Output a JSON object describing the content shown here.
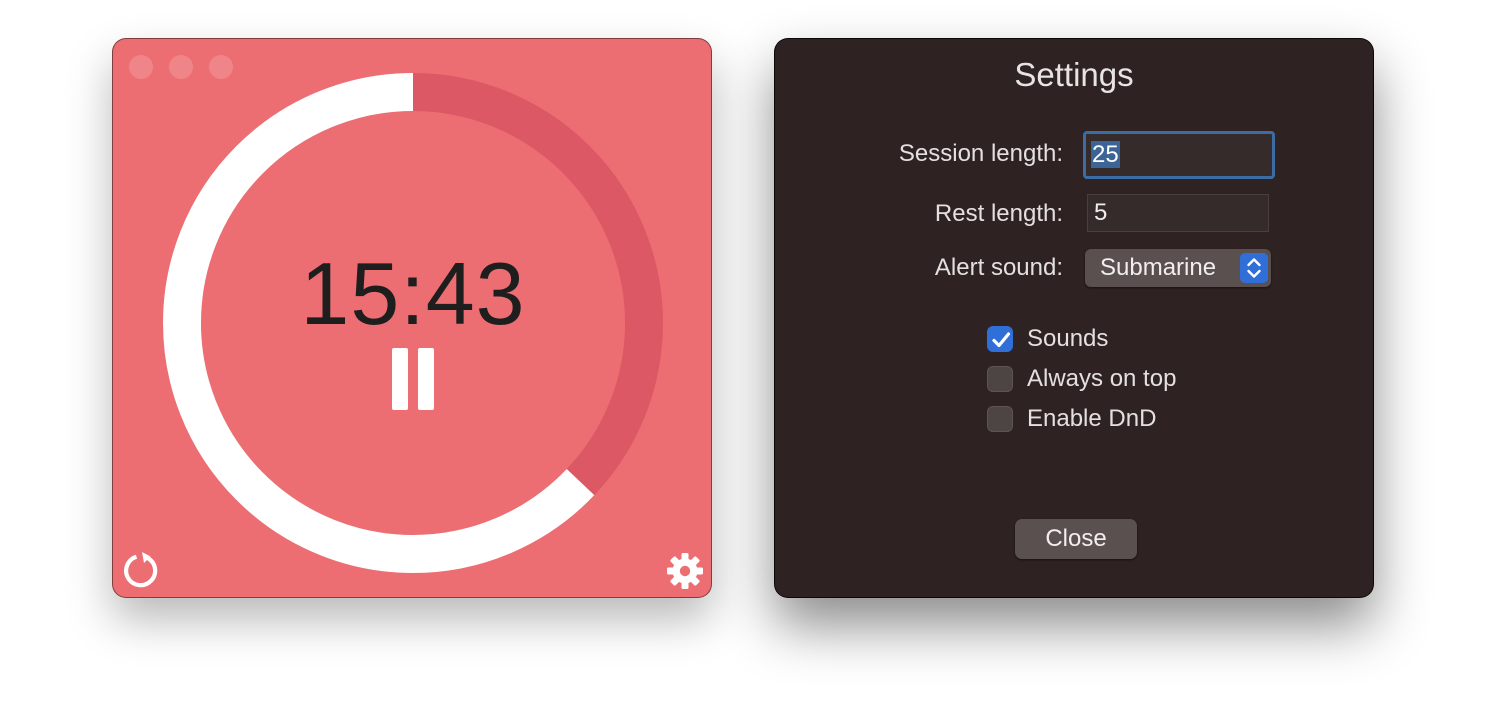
{
  "timer": {
    "time_display": "15:43",
    "progress_fraction": 0.371,
    "colors": {
      "background": "#ec6e72",
      "track": "#dc5864",
      "progress": "#ffffff",
      "text": "#1e1e1e"
    },
    "icons": {
      "pause": "pause-icon",
      "reset": "reset-icon",
      "settings": "gear-icon"
    }
  },
  "settings": {
    "title": "Settings",
    "session_length_label": "Session length:",
    "session_length_value": "25",
    "rest_length_label": "Rest length:",
    "rest_length_value": "5",
    "alert_sound_label": "Alert sound:",
    "alert_sound_value": "Submarine",
    "options": [
      {
        "label": "Sounds",
        "checked": true
      },
      {
        "label": "Always on top",
        "checked": false
      },
      {
        "label": "Enable DnD",
        "checked": false
      }
    ],
    "close_label": "Close",
    "colors": {
      "background": "#2e2222",
      "accent": "#2f6fd7",
      "focus_ring": "#3b6da3"
    }
  }
}
